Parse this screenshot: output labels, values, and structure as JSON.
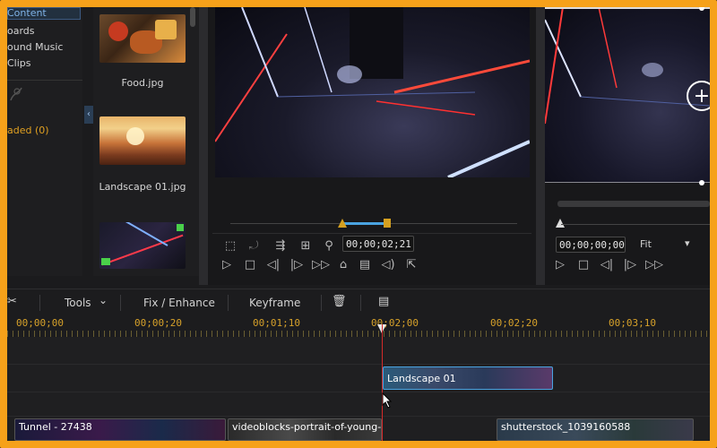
{
  "library": {
    "categories": [
      "Content",
      "oards",
      "ound Music",
      "Clips"
    ],
    "uploaded_label": "aded (0)",
    "collapse_arrow": "‹",
    "items": [
      {
        "label": "Food.jpg"
      },
      {
        "label": "Landscape 01.jpg"
      },
      {
        "label": ""
      }
    ]
  },
  "player_left": {
    "timecode": "00;00;02;21"
  },
  "player_right": {
    "timecode": "00;00;00;00",
    "fit_label": "Fit",
    "fit_arrow": "▾"
  },
  "toolbar": {
    "tools_label": "Tools",
    "tools_arrow": "⌄",
    "fix_label": "Fix / Enhance",
    "keyframe_label": "Keyframe"
  },
  "ruler": {
    "labels": [
      "00;00;00",
      "00;00;20",
      "00;01;10",
      "00;02;00",
      "00;02;20",
      "00;03;10"
    ]
  },
  "clips": {
    "overlay_clip": "Landscape 01",
    "track_clips": [
      "Tunnel - 27438",
      "videoblocks-portrait-of-young-b",
      "shutterstock_1039160588"
    ]
  },
  "colors": {
    "frame": "#f6a11a",
    "accent_blue": "#4aa3e0",
    "ruler_text": "#d6a12a",
    "playhead": "#d32a2a"
  }
}
